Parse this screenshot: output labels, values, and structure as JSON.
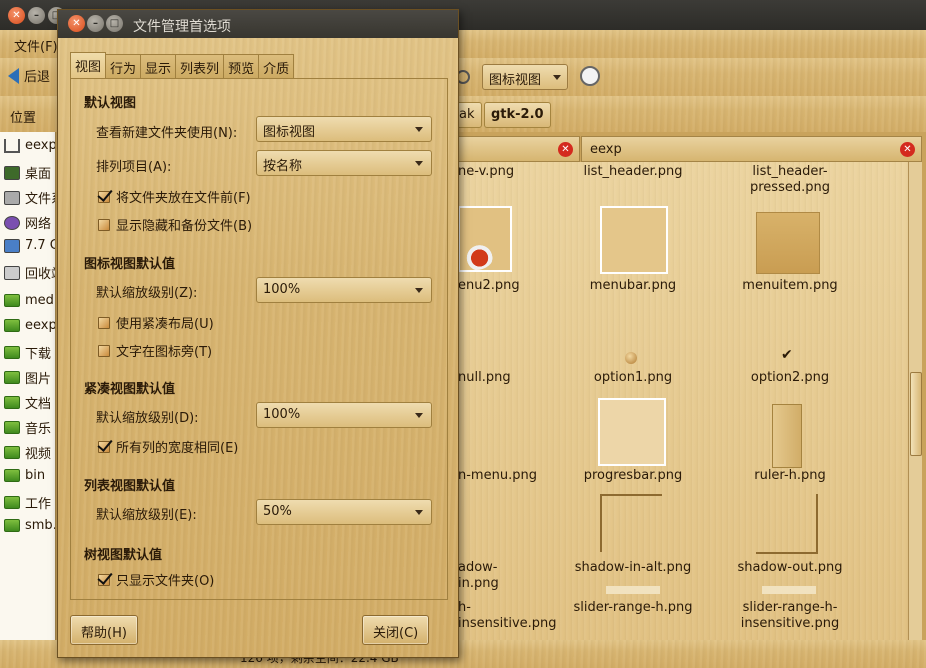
{
  "main": {
    "menu": [
      "文件(F)"
    ],
    "back_label": "后退",
    "view_mode": "图标视图",
    "places_title": "位置",
    "path_buttons": [
      "ak",
      "gtk-2.0"
    ],
    "sidebar": [
      "eexp",
      "桌面",
      "文件系",
      "网络",
      "7.7 G",
      "回收站",
      "medi",
      "eexp",
      "下载",
      "图片",
      "文档",
      "音乐",
      "视频",
      "bin",
      "工作",
      "smb.."
    ],
    "left_pane_title": "",
    "right_pane_title": "eexp",
    "files": [
      [
        "ne-v.png",
        "list_header.png",
        "list_header-pressed.png"
      ],
      [
        "enu2.png",
        "menubar.png",
        "menuitem.png"
      ],
      [
        "null.png",
        "option1.png",
        "option2.png"
      ],
      [
        "n-menu.png",
        "progresbar.png",
        "ruler-h.png"
      ],
      [
        "adow-in.png",
        "shadow-in-alt.png",
        "shadow-out.png"
      ],
      [
        "h-insensitive.png",
        "slider-range-h.png",
        "slider-range-h-insensitive.png"
      ]
    ],
    "status": "126 项，剩余空间：22.4 GB"
  },
  "dialog": {
    "title": "文件管理首选项",
    "tabs": [
      "视图",
      "行为",
      "显示",
      "列表列",
      "预览",
      "介质"
    ],
    "default_view": {
      "title": "默认视图",
      "new_folder_label": "查看新建文件夹使用(N):",
      "new_folder_value": "图标视图",
      "sort_label": "排列项目(A):",
      "sort_value": "按名称",
      "folders_first": "将文件夹放在文件前(F)",
      "show_hidden": "显示隐藏和备份文件(B)"
    },
    "icon_view": {
      "title": "图标视图默认值",
      "zoom_label": "默认缩放级别(Z):",
      "zoom_value": "100%",
      "compact": "使用紧凑布局(U)",
      "text_beside": "文字在图标旁(T)"
    },
    "compact_view": {
      "title": "紧凑视图默认值",
      "zoom_label": "默认缩放级别(D):",
      "zoom_value": "100%",
      "same_width": "所有列的宽度相同(E)"
    },
    "list_view": {
      "title": "列表视图默认值",
      "zoom_label": "默认缩放级别(E):",
      "zoom_value": "50%"
    },
    "tree_view": {
      "title": "树视图默认值",
      "folders_only": "只显示文件夹(O)"
    },
    "help_button": "帮助(H)",
    "close_button": "关闭(C)"
  }
}
